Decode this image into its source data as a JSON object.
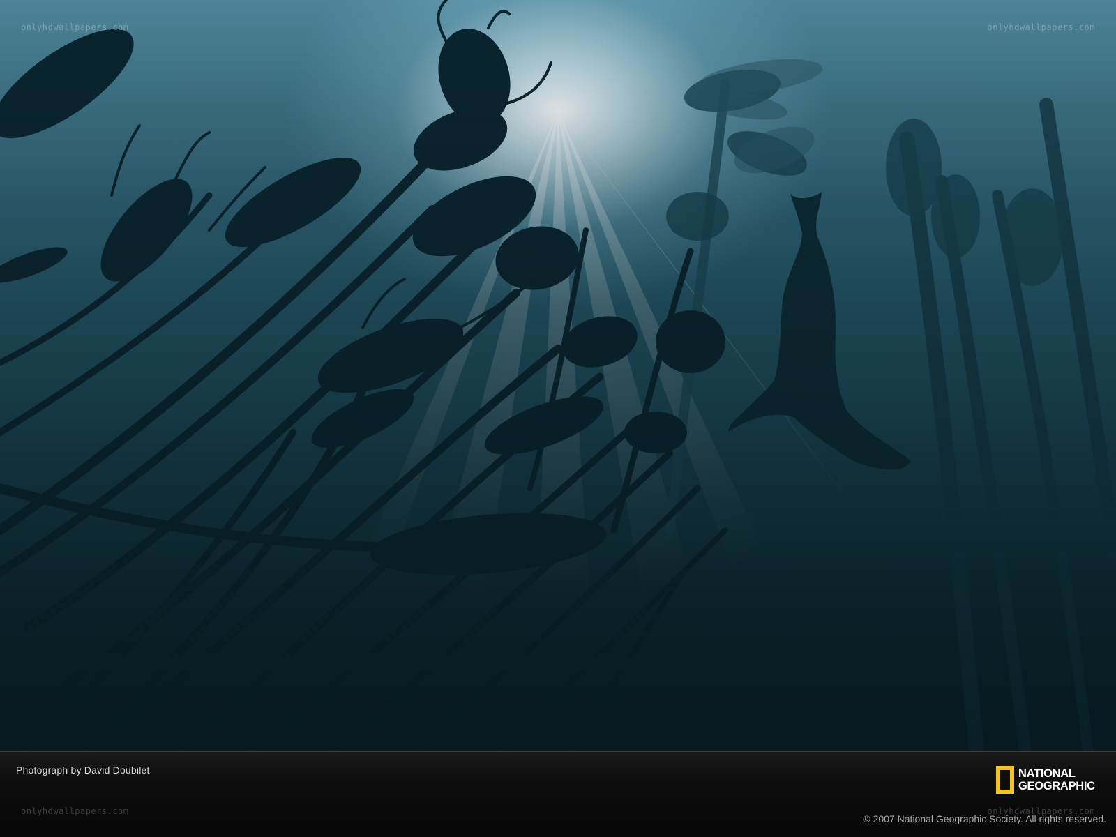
{
  "photo": {
    "subject_icon": "seal-silhouette-icon"
  },
  "caption": {
    "credit": "Photograph by David Doubilet",
    "copyright": "© 2007 National Geographic Society. All rights reserved."
  },
  "logo": {
    "line1": "NATIONAL",
    "line2": "GEOGRAPHIC",
    "frame_color": "#f6c41c"
  },
  "watermarks": {
    "top_left": "onlyhdwallpapers.com",
    "top_right": "onlyhdwallpapers.com",
    "bottom_left": "onlyhdwallpapers.com",
    "bottom_right": "onlyhdwallpapers.com"
  },
  "colors": {
    "water_light": "#4f8498",
    "water_dark": "#0a1f27",
    "kelp": "#0b2530"
  }
}
